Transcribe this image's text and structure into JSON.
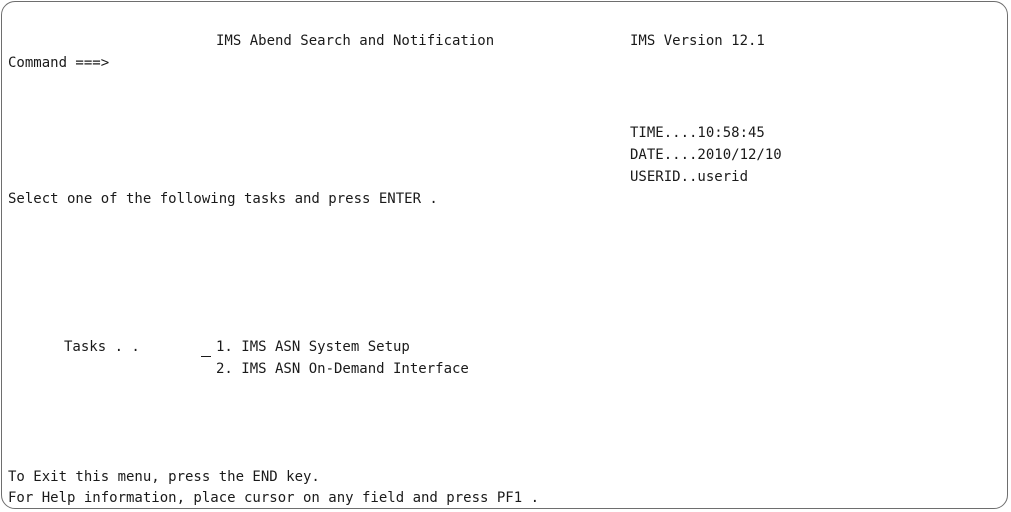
{
  "header": {
    "title": "IMS Abend Search and Notification",
    "version": "IMS Version 12.1"
  },
  "command": {
    "label": "Command ===>",
    "value": ""
  },
  "info": {
    "time": "TIME....10:58:45",
    "date": "DATE....2010/12/10",
    "userid": "USERID..userid"
  },
  "instruction": "Select one of the following tasks and press ENTER .",
  "tasks": {
    "label": "Tasks . .",
    "selection": "",
    "items": [
      {
        "label": "1. IMS ASN System Setup"
      },
      {
        "label": "2. IMS ASN On-Demand Interface"
      }
    ]
  },
  "footer": {
    "exit": "To Exit this menu, press the END key.",
    "help": "For Help information, place cursor on any field and press PF1 ."
  }
}
